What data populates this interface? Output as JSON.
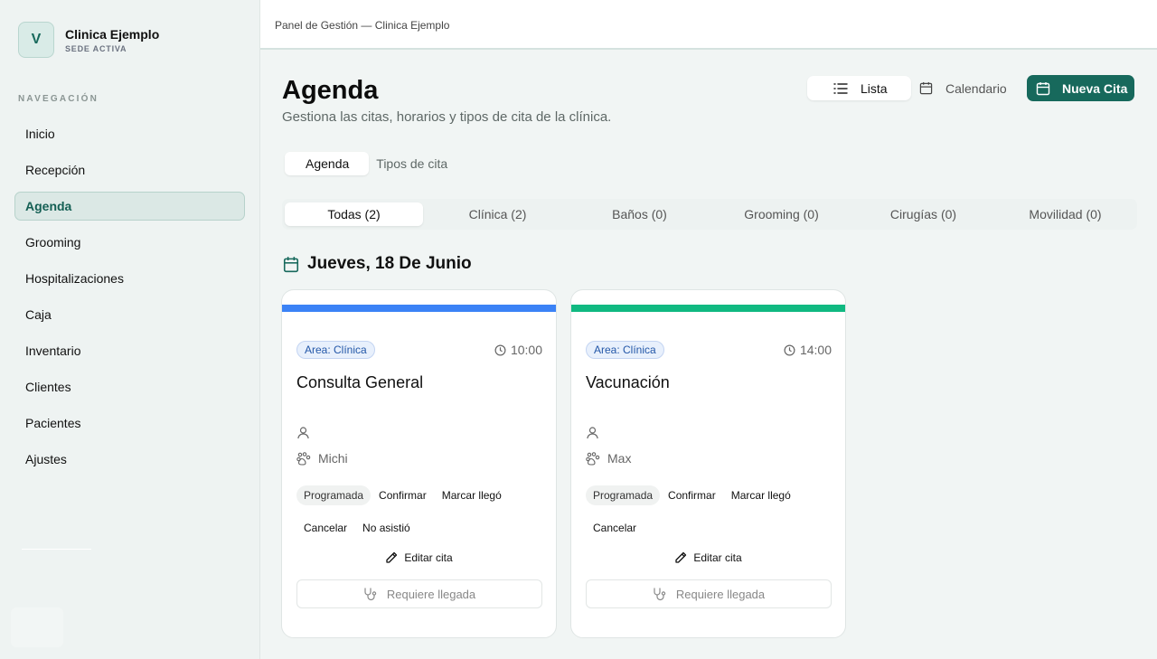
{
  "brand": {
    "initial": "V",
    "name": "Clinica Ejemplo",
    "subtitle": "SEDE ACTIVA"
  },
  "sidebar": {
    "heading": "NAVEGACIÓN",
    "items": [
      {
        "label": "Inicio"
      },
      {
        "label": "Recepción"
      },
      {
        "label": "Agenda"
      },
      {
        "label": "Grooming"
      },
      {
        "label": "Hospitalizaciones"
      },
      {
        "label": "Caja"
      },
      {
        "label": "Inventario"
      },
      {
        "label": "Clientes"
      },
      {
        "label": "Pacientes"
      },
      {
        "label": "Ajustes"
      }
    ],
    "active": "Agenda"
  },
  "topbar": {
    "title": "Panel de Gestión — Clinica Ejemplo"
  },
  "header": {
    "title": "Agenda",
    "subtitle": "Gestiona las citas, horarios y tipos de cita de la clínica.",
    "view_list": "Lista",
    "view_calendar": "Calendario",
    "new_button": "Nueva Cita"
  },
  "tabs": [
    {
      "label": "Agenda"
    },
    {
      "label": "Tipos de cita"
    }
  ],
  "filters": [
    {
      "label": "Todas (2)"
    },
    {
      "label": "Clínica (2)"
    },
    {
      "label": "Baños (0)"
    },
    {
      "label": "Grooming (0)"
    },
    {
      "label": "Cirugías (0)"
    },
    {
      "label": "Movilidad (0)"
    }
  ],
  "date_heading": "Jueves, 18 De Junio",
  "cards": [
    {
      "stripe_color": "#3b82f6",
      "area": "Area: Clínica",
      "time": "10:00",
      "title": "Consulta General",
      "pet": "Michi",
      "status": "Programada",
      "actions": [
        "Confirmar",
        "Marcar llegó",
        "Cancelar",
        "No asistió"
      ],
      "edit": "Editar cita",
      "arrival": "Requiere llegada"
    },
    {
      "stripe_color": "#10b981",
      "area": "Area: Clínica",
      "time": "14:00",
      "title": "Vacunación",
      "pet": "Max",
      "status": "Programada",
      "actions": [
        "Confirmar",
        "Marcar llegó",
        "Cancelar"
      ],
      "edit": "Editar cita",
      "arrival": "Requiere llegada"
    }
  ],
  "colors": {
    "primary": "#17695c",
    "area_badge": "#2357a8"
  }
}
